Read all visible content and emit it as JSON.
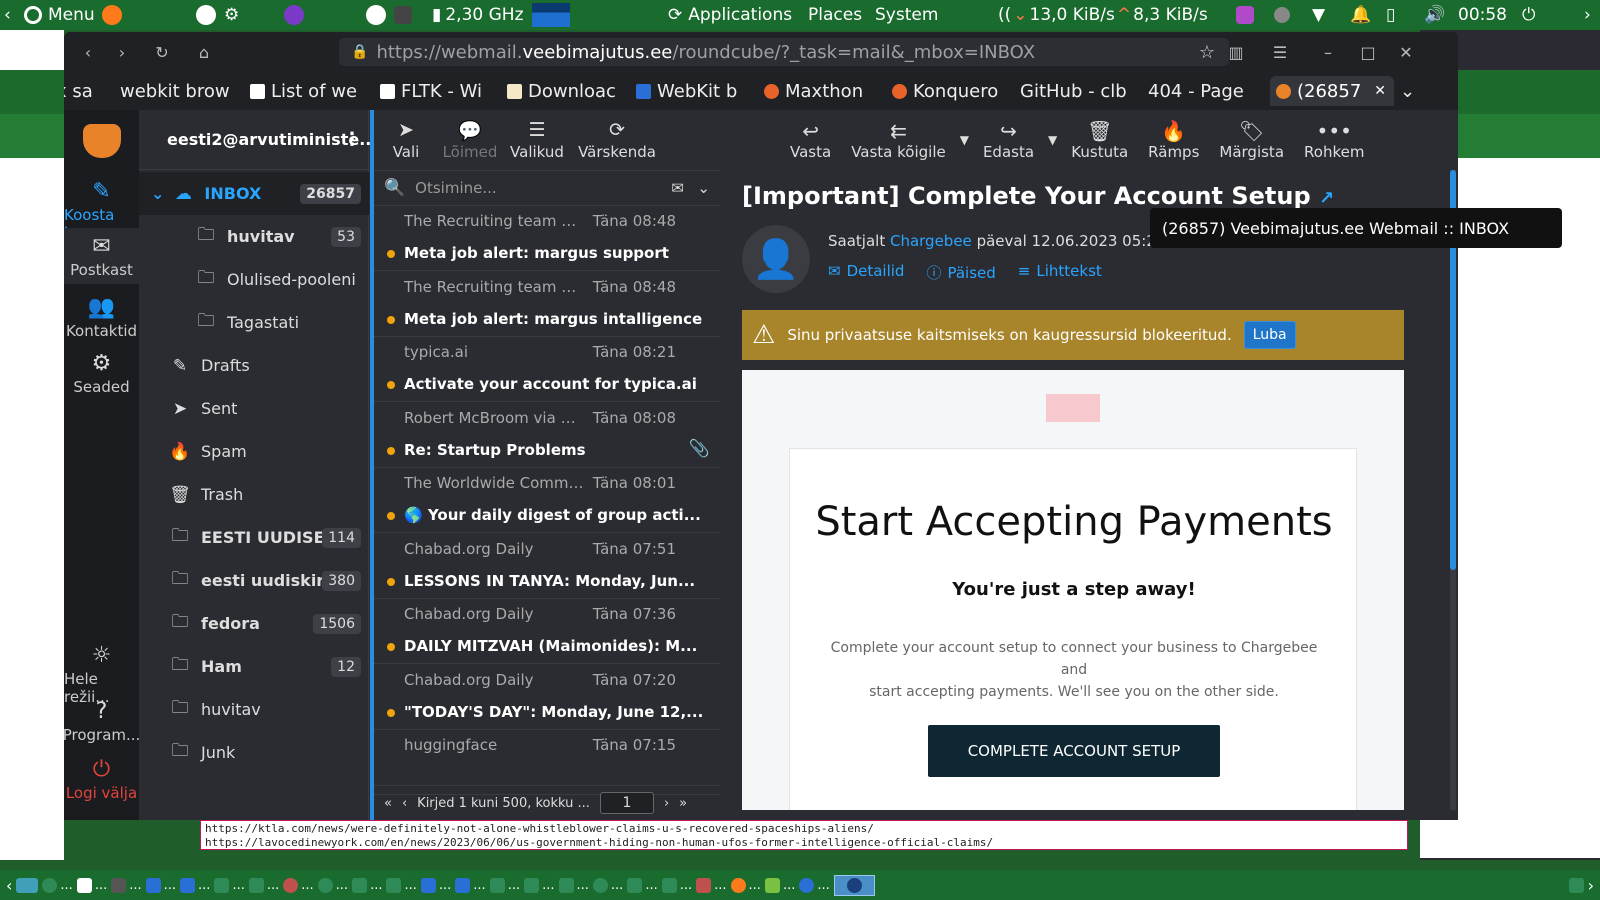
{
  "system_panel": {
    "menu_label": "Menu",
    "cpu_freq": "2,30 GHz",
    "menus": [
      "Applications",
      "Places",
      "System"
    ],
    "net_down": "13,0 KiB/s",
    "net_up": "8,3 KiB/s",
    "clock": "00:58"
  },
  "browser": {
    "url_prefix": "https://webmail.",
    "url_domain": "veebimajutus.ee",
    "url_rest": "/roundcube/?_task=mail&_mbox=INBOX",
    "tabs": [
      {
        "label": "x sa"
      },
      {
        "label": "webkit brow"
      },
      {
        "label": "List of we"
      },
      {
        "label": "FLTK - Wi"
      },
      {
        "label": "Downloac"
      },
      {
        "label": "WebKit b"
      },
      {
        "label": "Maxthon"
      },
      {
        "label": "Konquero"
      },
      {
        "label": "GitHub - clb"
      },
      {
        "label": "404 - Page"
      },
      {
        "label": "(26857"
      }
    ],
    "tooltip": "(26857) Veebimajutus.ee Webmail :: INBOX"
  },
  "rail": {
    "compose": "Koosta k...",
    "mail": "Postkast",
    "contacts": "Kontaktid",
    "settings": "Seaded",
    "theme": "Hele režii...",
    "about": "Program...",
    "logout": "Logi välja"
  },
  "account": "eesti2@arvutiministe...",
  "folders": [
    {
      "name": "INBOX",
      "count": "26857",
      "icon": "inbox-icon"
    },
    {
      "name": "huvitav",
      "count": "53",
      "icon": "folder-icon"
    },
    {
      "name": "Olulised-pooleni",
      "count": "",
      "icon": "folder-icon"
    },
    {
      "name": "Tagastati",
      "count": "",
      "icon": "folder-icon"
    },
    {
      "name": "Drafts",
      "count": "",
      "icon": "pencil-icon"
    },
    {
      "name": "Sent",
      "count": "",
      "icon": "send-icon"
    },
    {
      "name": "Spam",
      "count": "",
      "icon": "flame-icon"
    },
    {
      "name": "Trash",
      "count": "",
      "icon": "trash-icon"
    },
    {
      "name": "EESTI UUDISE...",
      "count": "114",
      "icon": "folder-icon"
    },
    {
      "name": "eesti uudiskir...",
      "count": "380",
      "icon": "folder-icon"
    },
    {
      "name": "fedora",
      "count": "1506",
      "icon": "folder-icon"
    },
    {
      "name": "Ham",
      "count": "12",
      "icon": "folder-icon"
    },
    {
      "name": "huvitav",
      "count": "",
      "icon": "folder-icon"
    },
    {
      "name": "Junk",
      "count": "",
      "icon": "folder-icon"
    }
  ],
  "list_toolbar": {
    "select": "Vali",
    "threads": "Lõimed",
    "options": "Valikud",
    "refresh": "Värskenda"
  },
  "search_placeholder": "Otsimine...",
  "messages": [
    {
      "from": "The Recruiting team at ...",
      "date": "Täna 08:48",
      "subject": "Meta job alert: margus support",
      "attach": false
    },
    {
      "from": "The Recruiting team at ...",
      "date": "Täna 08:48",
      "subject": "Meta job alert: margus intalligence",
      "attach": false
    },
    {
      "from": "typica.ai",
      "date": "Täna 08:21",
      "subject": "Activate your account for typica.ai",
      "attach": false
    },
    {
      "from": "Robert McBroom via use...",
      "date": "Täna 08:08",
      "subject": "Re: Startup Problems",
      "attach": true
    },
    {
      "from": "The Worldwide Commun...",
      "date": "Täna 08:01",
      "subject": "🌎 Your daily digest of group acti...",
      "attach": false
    },
    {
      "from": "Chabad.org Daily",
      "date": "Täna 07:51",
      "subject": "LESSONS IN TANYA: Monday, Jun...",
      "attach": false
    },
    {
      "from": "Chabad.org Daily",
      "date": "Täna 07:36",
      "subject": "DAILY MITZVAH (Maimonides): M...",
      "attach": false
    },
    {
      "from": "Chabad.org Daily",
      "date": "Täna 07:20",
      "subject": "\"TODAY'S DAY\": Monday, June 12,...",
      "attach": false
    },
    {
      "from": "huggingface",
      "date": "Täna 07:15",
      "subject": "",
      "attach": false
    }
  ],
  "pager": {
    "text": "Kirjed 1 kuni 500, kokku ...",
    "page": "1"
  },
  "preview_toolbar": {
    "reply": "Vasta",
    "reply_all": "Vasta kõigile",
    "forward": "Edasta",
    "delete": "Kustuta",
    "spam": "Rämps",
    "mark": "Märgista",
    "more": "Rohkem"
  },
  "mail": {
    "title": "[Important] Complete Your Account Setup",
    "from_prefix": "Saatjalt",
    "from_name": "Chargebee",
    "date_text": "päeval 12.06.2023 05:21",
    "links": {
      "details": "Detailid",
      "headers": "Päised",
      "plaintext": "Lihttekst"
    },
    "privacy_text": "Sinu privaatsuse kaitsmiseks on kaugressursid blokeeritud.",
    "privacy_button": "Luba",
    "heading": "Start Accepting Payments",
    "subheading": "You're just a step away!",
    "body_line1": "Complete your account setup to connect your business to Chargebee",
    "body_line2": "and",
    "body_line3": "start accepting payments. We'll see you on the other side.",
    "cta": "COMPLETE ACCOUNT SETUP"
  },
  "bottom_text": {
    "line1": "https://ktla.com/news/were-definitely-not-alone-whistleblower-claims-u-s-recovered-spaceships-aliens/",
    "line2": "https://lavocedinewyork.com/en/news/2023/06/06/us-government-hiding-non-human-ufos-former-intelligence-official-claims/"
  },
  "taskbar_ellipsis": "..."
}
